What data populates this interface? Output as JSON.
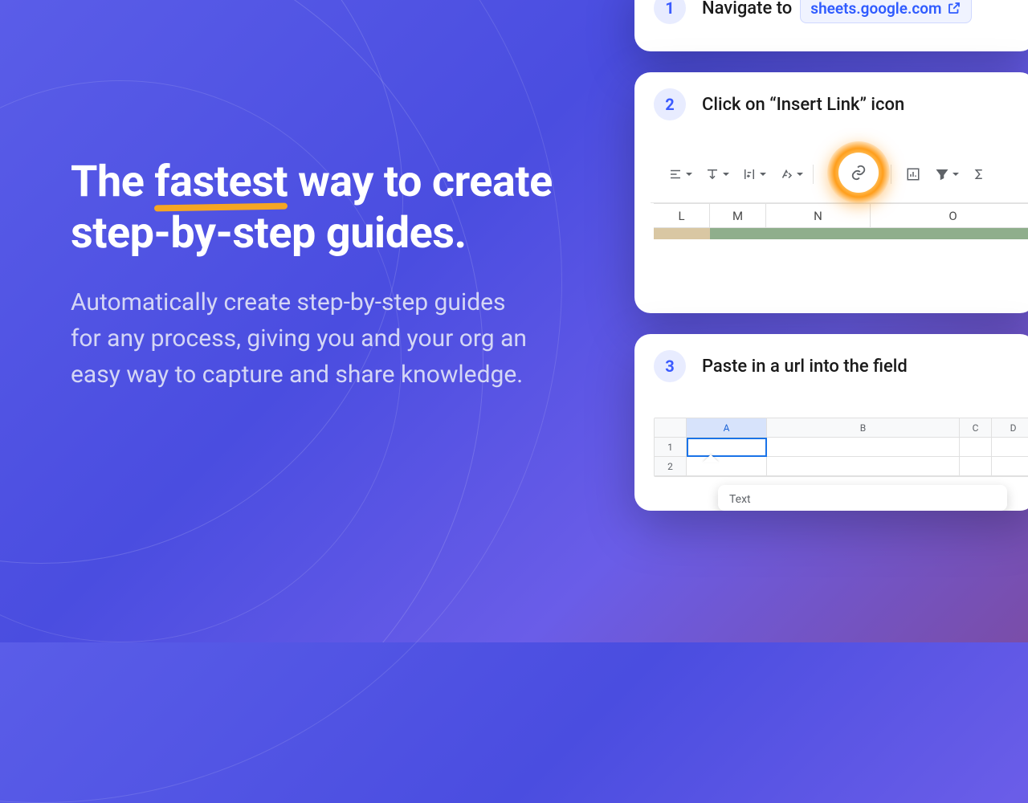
{
  "hero": {
    "title_1": "The ",
    "title_emph": "fastest",
    "title_2": " way to create step-by-step guides.",
    "subtitle": "Automatically create step-by-step guides for any process, giving you and your org an easy way to capture and share knowledge."
  },
  "steps": [
    {
      "num": "1",
      "prefix": "Navigate to ",
      "link": "sheets.google.com"
    },
    {
      "num": "2",
      "title": "Click on “Insert Link” icon",
      "columns": [
        "L",
        "M",
        "N",
        "O"
      ]
    },
    {
      "num": "3",
      "title": "Paste in a url into the field",
      "sheet_cols": [
        "A",
        "B",
        "C",
        "D"
      ],
      "sheet_rows": [
        "1",
        "2"
      ],
      "popover_label": "Text"
    }
  ],
  "colors": {
    "accent": "#f5a623",
    "link": "#2f5bff"
  }
}
